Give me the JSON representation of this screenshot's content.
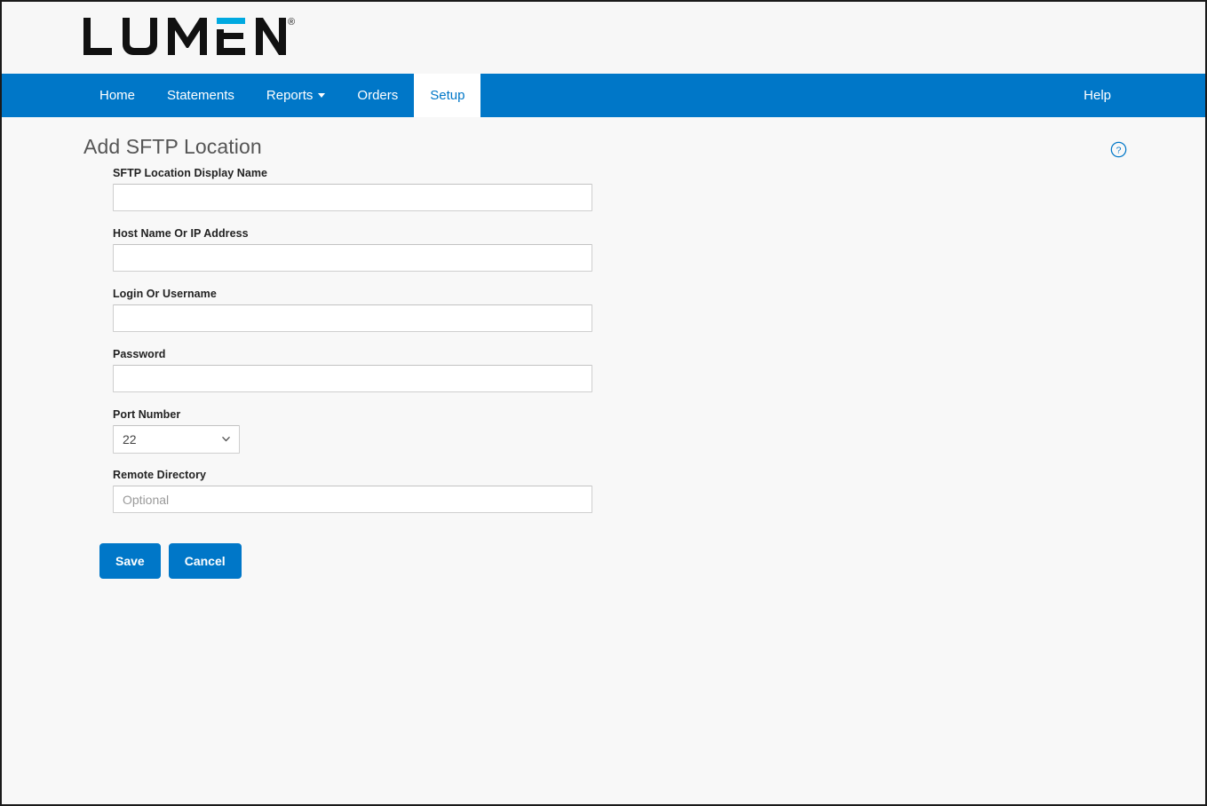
{
  "brand": {
    "logo_text": "LUMEN",
    "registered_mark": "®",
    "accent_color": "#0077c8",
    "logo_color": "#111111"
  },
  "nav": {
    "items": [
      {
        "label": "Home",
        "id": "home",
        "active": false,
        "has_caret": false
      },
      {
        "label": "Statements",
        "id": "statements",
        "active": false,
        "has_caret": false
      },
      {
        "label": "Reports",
        "id": "reports",
        "active": false,
        "has_caret": true
      },
      {
        "label": "Orders",
        "id": "orders",
        "active": false,
        "has_caret": false
      },
      {
        "label": "Setup",
        "id": "setup",
        "active": true,
        "has_caret": false
      }
    ],
    "help_label": "Help"
  },
  "page": {
    "title": "Add SFTP Location",
    "help_icon": "question-circle-icon"
  },
  "form": {
    "fields": [
      {
        "label": "SFTP Location Display Name",
        "value": "",
        "placeholder": "",
        "type": "text"
      },
      {
        "label": "Host Name Or IP Address",
        "value": "",
        "placeholder": "",
        "type": "text"
      },
      {
        "label": "Login Or Username",
        "value": "",
        "placeholder": "",
        "type": "text"
      },
      {
        "label": "Password",
        "value": "",
        "placeholder": "",
        "type": "password"
      }
    ],
    "port": {
      "label": "Port Number",
      "value": "22",
      "options": [
        "22"
      ]
    },
    "remote_directory": {
      "label": "Remote Directory",
      "value": "",
      "placeholder": "Optional"
    }
  },
  "actions": {
    "save_label": "Save",
    "cancel_label": "Cancel"
  }
}
